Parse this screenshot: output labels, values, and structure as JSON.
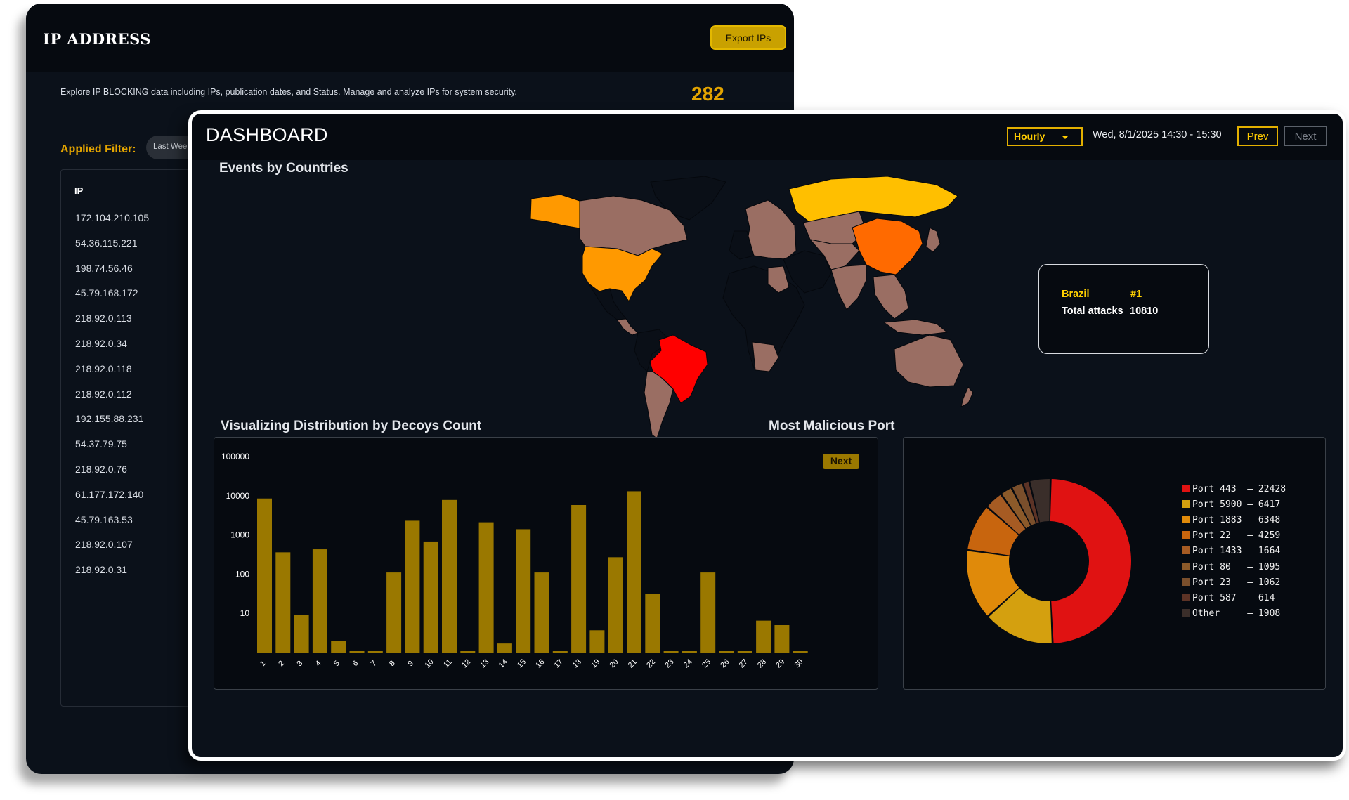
{
  "ip_panel": {
    "title": "IP ADDRESS",
    "export_label": "Export IPs",
    "description": "Explore IP BLOCKING data including IPs, publication dates, and Status. Manage and analyze IPs for system security.",
    "total_count": "282",
    "filter_label": "Applied Filter:",
    "filter_chip": "Last Wee",
    "column_header": "IP",
    "ips": [
      "172.104.210.105",
      "54.36.115.221",
      "198.74.56.46",
      "45.79.168.172",
      "218.92.0.113",
      "218.92.0.34",
      "218.92.0.118",
      "218.92.0.112",
      "192.155.88.231",
      "54.37.79.75",
      "218.92.0.76",
      "61.177.172.140",
      "45.79.163.53",
      "218.92.0.107",
      "218.92.0.31"
    ]
  },
  "dashboard": {
    "title": "DASHBOARD",
    "interval": "Hourly",
    "range": "Wed, 8/1/2025 14:30 - 15:30",
    "prev_label": "Prev",
    "next_label": "Next",
    "map": {
      "title": "Events by Countries",
      "colors": {
        "top": "#ff0000",
        "high": "#ff6a00",
        "mid": "#ff9900",
        "elevated": "#ffbf00",
        "low": "#9a6e63",
        "none": "#0a0f17"
      },
      "highlighted_countries": [
        {
          "name": "Brazil",
          "level": "top"
        },
        {
          "name": "China",
          "level": "high"
        },
        {
          "name": "United States",
          "level": "mid"
        },
        {
          "name": "Russia",
          "level": "elevated"
        }
      ],
      "tooltip": {
        "country": "Brazil",
        "rank": "#1",
        "metric_label": "Total attacks",
        "metric_value": "10810"
      }
    },
    "decoys": {
      "title": "Visualizing Distribution by Decoys Count",
      "next_label": "Next"
    },
    "ports": {
      "title": "Most Malicious Port"
    }
  },
  "chart_data": [
    {
      "type": "bar",
      "title": "Visualizing Distribution by Decoys Count",
      "scale": "log",
      "ylim": [
        1,
        100000
      ],
      "yticks": [
        "100000",
        "10000",
        "1000",
        "100",
        "10"
      ],
      "categories": [
        "1",
        "2",
        "3",
        "4",
        "5",
        "6",
        "7",
        "8",
        "9",
        "10",
        "11",
        "12",
        "13",
        "14",
        "15",
        "16",
        "17",
        "18",
        "19",
        "20",
        "21",
        "22",
        "23",
        "24",
        "25",
        "26",
        "27",
        "28",
        "29",
        "30"
      ],
      "values": [
        8500,
        360,
        9,
        430,
        2,
        1,
        1,
        110,
        2300,
        680,
        7800,
        1,
        2100,
        1.7,
        1400,
        110,
        1,
        5800,
        3.7,
        270,
        13000,
        31,
        1,
        1,
        110,
        1,
        1,
        6.5,
        5,
        1
      ],
      "color": "#9a7800"
    },
    {
      "type": "pie",
      "title": "Most Malicious Port",
      "labels": [
        "Port 443",
        "Port 5900",
        "Port 1883",
        "Port 22",
        "Port 1433",
        "Port 80",
        "Port 23",
        "Port 587",
        "Other"
      ],
      "values": [
        22428,
        6417,
        6348,
        4259,
        1664,
        1095,
        1062,
        614,
        1908
      ],
      "colors": [
        "#e01212",
        "#d4a00f",
        "#e08a0a",
        "#c8650e",
        "#a65b23",
        "#8c5a2a",
        "#7a4f2c",
        "#5c3326",
        "#3a2e2a"
      ]
    }
  ]
}
